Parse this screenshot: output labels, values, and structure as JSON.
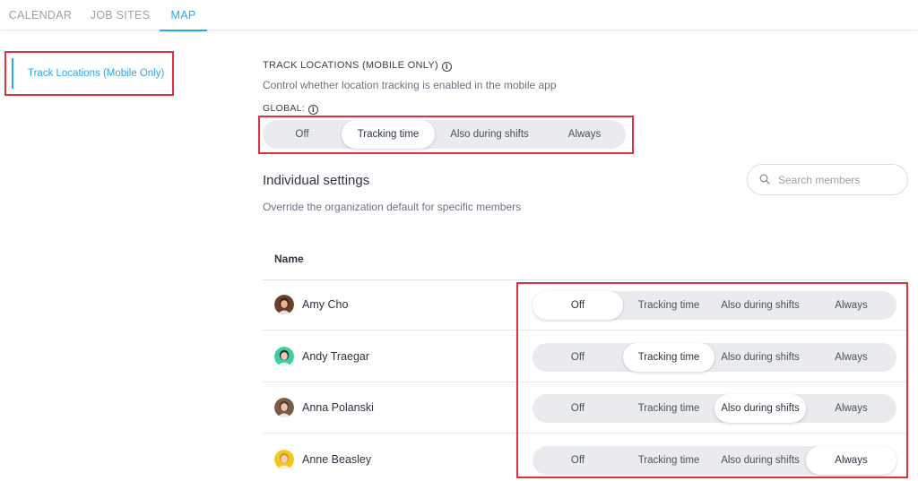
{
  "topnav": {
    "tabs": [
      {
        "label": "CALENDAR",
        "active": false
      },
      {
        "label": "JOB SITES",
        "active": false
      },
      {
        "label": "MAP",
        "active": true
      }
    ]
  },
  "sidebar": {
    "items": [
      {
        "label": "Track Locations (Mobile Only)",
        "active": true
      }
    ]
  },
  "track_section": {
    "title": "TRACK LOCATIONS (MOBILE ONLY)",
    "description": "Control whether location tracking is enabled in the mobile app",
    "global_label": "GLOBAL:",
    "options": [
      "Off",
      "Tracking time",
      "Also during shifts",
      "Always"
    ],
    "global_selected": "Tracking time"
  },
  "individual": {
    "title": "Individual settings",
    "description": "Override the organization default for specific members",
    "search_placeholder": "Search members",
    "column_name": "Name",
    "members": [
      {
        "name": "Amy Cho",
        "selected": "Off"
      },
      {
        "name": "Andy Traegar",
        "selected": "Tracking time"
      },
      {
        "name": "Anna Polanski",
        "selected": "Also during shifts"
      },
      {
        "name": "Anne Beasley",
        "selected": "Always"
      }
    ]
  },
  "colors": {
    "accent": "#2aa7e6",
    "highlight_border": "#e0303f",
    "segment_bg": "#e9ebef"
  },
  "icons": {
    "info": "info-circle-icon",
    "search": "search-icon",
    "avatar": "avatar"
  }
}
